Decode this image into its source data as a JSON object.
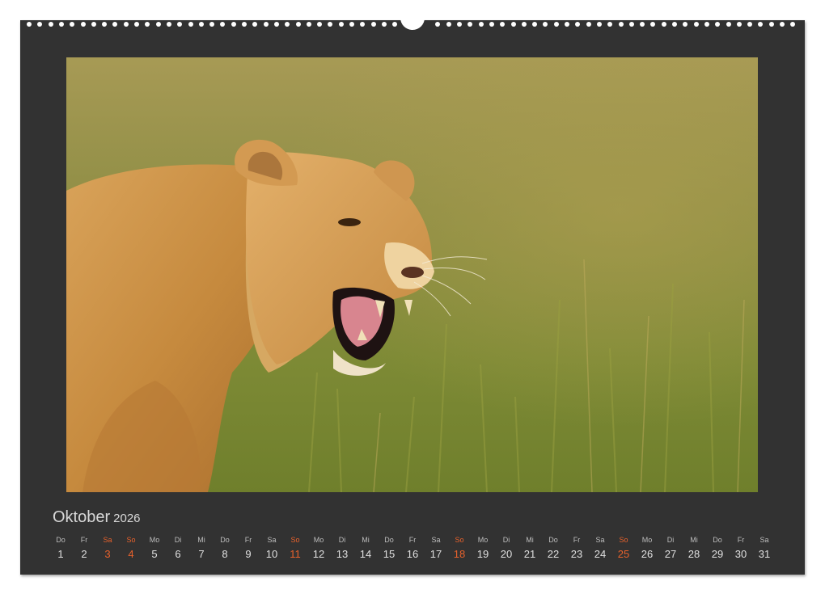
{
  "calendar": {
    "month": "Oktober",
    "year": "2026",
    "accent_color": "#e8622c",
    "days": [
      {
        "wd": "Do",
        "n": "1",
        "sun": false
      },
      {
        "wd": "Fr",
        "n": "2",
        "sun": false
      },
      {
        "wd": "Sa",
        "n": "3",
        "sun": true
      },
      {
        "wd": "So",
        "n": "4",
        "sun": true
      },
      {
        "wd": "Mo",
        "n": "5",
        "sun": false
      },
      {
        "wd": "Di",
        "n": "6",
        "sun": false
      },
      {
        "wd": "Mi",
        "n": "7",
        "sun": false
      },
      {
        "wd": "Do",
        "n": "8",
        "sun": false
      },
      {
        "wd": "Fr",
        "n": "9",
        "sun": false
      },
      {
        "wd": "Sa",
        "n": "10",
        "sun": false
      },
      {
        "wd": "So",
        "n": "11",
        "sun": true
      },
      {
        "wd": "Mo",
        "n": "12",
        "sun": false
      },
      {
        "wd": "Di",
        "n": "13",
        "sun": false
      },
      {
        "wd": "Mi",
        "n": "14",
        "sun": false
      },
      {
        "wd": "Do",
        "n": "15",
        "sun": false
      },
      {
        "wd": "Fr",
        "n": "16",
        "sun": false
      },
      {
        "wd": "Sa",
        "n": "17",
        "sun": false
      },
      {
        "wd": "So",
        "n": "18",
        "sun": true
      },
      {
        "wd": "Mo",
        "n": "19",
        "sun": false
      },
      {
        "wd": "Di",
        "n": "20",
        "sun": false
      },
      {
        "wd": "Mi",
        "n": "21",
        "sun": false
      },
      {
        "wd": "Do",
        "n": "22",
        "sun": false
      },
      {
        "wd": "Fr",
        "n": "23",
        "sun": false
      },
      {
        "wd": "Sa",
        "n": "24",
        "sun": false
      },
      {
        "wd": "So",
        "n": "25",
        "sun": true
      },
      {
        "wd": "Mo",
        "n": "26",
        "sun": false
      },
      {
        "wd": "Di",
        "n": "27",
        "sun": false
      },
      {
        "wd": "Mi",
        "n": "28",
        "sun": false
      },
      {
        "wd": "Do",
        "n": "29",
        "sun": false
      },
      {
        "wd": "Fr",
        "n": "30",
        "sun": false
      },
      {
        "wd": "Sa",
        "n": "31",
        "sun": false
      }
    ]
  },
  "photo": {
    "subject": "lioness-snarling-in-grass"
  }
}
